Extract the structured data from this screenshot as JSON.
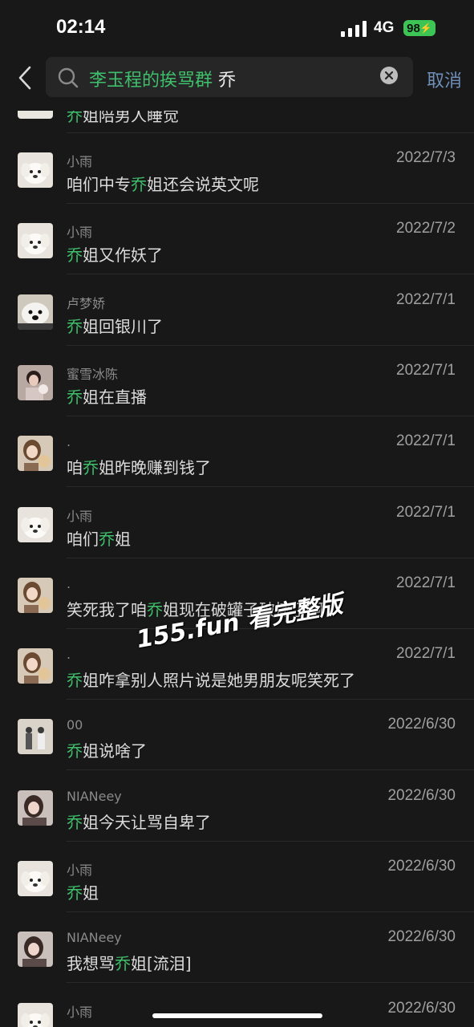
{
  "status": {
    "time": "02:14",
    "network": "4G",
    "battery": "98"
  },
  "search": {
    "chat_name": "李玉程的挨骂群",
    "keyword": "乔",
    "cancel_label": "取消"
  },
  "partial_row": {
    "hl": "乔",
    "post": "姐陪男人睡觉"
  },
  "results": [
    {
      "sender": "小雨",
      "date": "2022/7/3",
      "pre": "咱们中专",
      "hl": "乔",
      "post": "姐还会说英文呢",
      "avatar": "dog"
    },
    {
      "sender": "小雨",
      "date": "2022/7/2",
      "pre": "",
      "hl": "乔",
      "post": "姐又作妖了",
      "avatar": "dog"
    },
    {
      "sender": "卢梦娇",
      "date": "2022/7/1",
      "pre": "",
      "hl": "乔",
      "post": "姐回银川了",
      "avatar": "dog2"
    },
    {
      "sender": "蜜雪冰陈",
      "date": "2022/7/1",
      "pre": "",
      "hl": "乔",
      "post": "姐在直播",
      "avatar": "girl"
    },
    {
      "sender": ".",
      "date": "2022/7/1",
      "pre": "咱",
      "hl": "乔",
      "post": "姐昨晚赚到钱了",
      "avatar": "girl2"
    },
    {
      "sender": "小雨",
      "date": "2022/7/1",
      "pre": "咱们",
      "hl": "乔",
      "post": "姐",
      "avatar": "dog"
    },
    {
      "sender": ".",
      "date": "2022/7/1",
      "pre": "笑死我了咱",
      "hl": "乔",
      "post": "姐现在破罐子破摔了啊",
      "avatar": "girl2"
    },
    {
      "sender": ".",
      "date": "2022/7/1",
      "pre": "",
      "hl": "乔",
      "post": "姐咋拿别人照片说是她男朋友呢笑死了",
      "avatar": "girl2"
    },
    {
      "sender": "00",
      "date": "2022/6/30",
      "pre": "",
      "hl": "乔",
      "post": "姐说啥了",
      "avatar": "people"
    },
    {
      "sender": "NIANeey",
      "date": "2022/6/30",
      "pre": "",
      "hl": "乔",
      "post": "姐今天让骂自卑了",
      "avatar": "girl3"
    },
    {
      "sender": "小雨",
      "date": "2022/6/30",
      "pre": "",
      "hl": "乔",
      "post": "姐",
      "avatar": "dog"
    },
    {
      "sender": "NIANeey",
      "date": "2022/6/30",
      "pre": "我想骂",
      "hl": "乔",
      "post": "姐[流泪]",
      "avatar": "girl3"
    },
    {
      "sender": "小雨",
      "date": "2022/6/30",
      "pre": "",
      "hl": "",
      "post": "",
      "avatar": "dog"
    }
  ],
  "watermark": "155.fun 看完整版"
}
